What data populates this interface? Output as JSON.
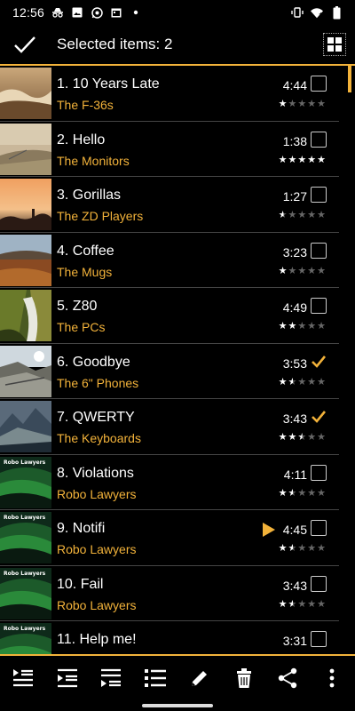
{
  "status_bar": {
    "time": "12:56",
    "left_icons": [
      "incognito-icon",
      "image-icon",
      "whatsapp-icon",
      "calendar-icon",
      "dot-icon"
    ],
    "right_icons": [
      "vibrate-icon",
      "wifi-icon",
      "battery-icon"
    ]
  },
  "toolbar": {
    "title": "Selected items: 2",
    "confirm_icon": "check-icon",
    "view_icon": "grid-icon"
  },
  "colors": {
    "accent": "#f2b23a",
    "background": "#000000",
    "divider": "#444444"
  },
  "tracks": [
    {
      "title": "1. 10 Years Late",
      "artist": "The F-36s",
      "duration": "4:44",
      "rating": 1,
      "checked": false,
      "playing": false,
      "thumb": "sky-clouds"
    },
    {
      "title": "2. Hello",
      "artist": "The Monitors",
      "duration": "1:38",
      "rating": 5,
      "checked": false,
      "playing": false,
      "thumb": "hill-sunset"
    },
    {
      "title": "3. Gorillas",
      "artist": "The ZD Players",
      "duration": "1:27",
      "rating": 0.5,
      "checked": false,
      "playing": false,
      "thumb": "orange-sky"
    },
    {
      "title": "4. Coffee",
      "artist": "The Mugs",
      "duration": "3:23",
      "rating": 1,
      "checked": false,
      "playing": false,
      "thumb": "autumn-field"
    },
    {
      "title": "5. Z80",
      "artist": "The PCs",
      "duration": "4:49",
      "rating": 2,
      "checked": false,
      "playing": false,
      "thumb": "waterfall"
    },
    {
      "title": "6. Goodbye",
      "artist": "The 6\" Phones",
      "duration": "3:53",
      "rating": 1.5,
      "checked": true,
      "playing": false,
      "thumb": "rocky-coast"
    },
    {
      "title": "7. QWERTY",
      "artist": "The Keyboards",
      "duration": "3:43",
      "rating": 2.5,
      "checked": true,
      "playing": false,
      "thumb": "mountains"
    },
    {
      "title": "8. Violations",
      "artist": "Robo Lawyers",
      "duration": "4:11",
      "rating": 1.5,
      "checked": false,
      "playing": false,
      "thumb": "robo-lawyers"
    },
    {
      "title": "9. Notifi",
      "artist": "Robo Lawyers",
      "duration": "4:45",
      "rating": 1.5,
      "checked": false,
      "playing": true,
      "thumb": "robo-lawyers"
    },
    {
      "title": "10. Fail",
      "artist": "Robo Lawyers",
      "duration": "3:43",
      "rating": 1.5,
      "checked": false,
      "playing": false,
      "thumb": "robo-lawyers"
    },
    {
      "title": "11. Help me!",
      "artist": "",
      "duration": "3:31",
      "rating": 0,
      "checked": false,
      "playing": false,
      "thumb": "robo-lawyers"
    }
  ],
  "bottom_bar": {
    "icons": [
      "queue-top-icon",
      "queue-next-icon",
      "queue-end-icon",
      "list-icon",
      "edit-icon",
      "delete-icon",
      "share-icon",
      "more-vert-icon"
    ]
  }
}
